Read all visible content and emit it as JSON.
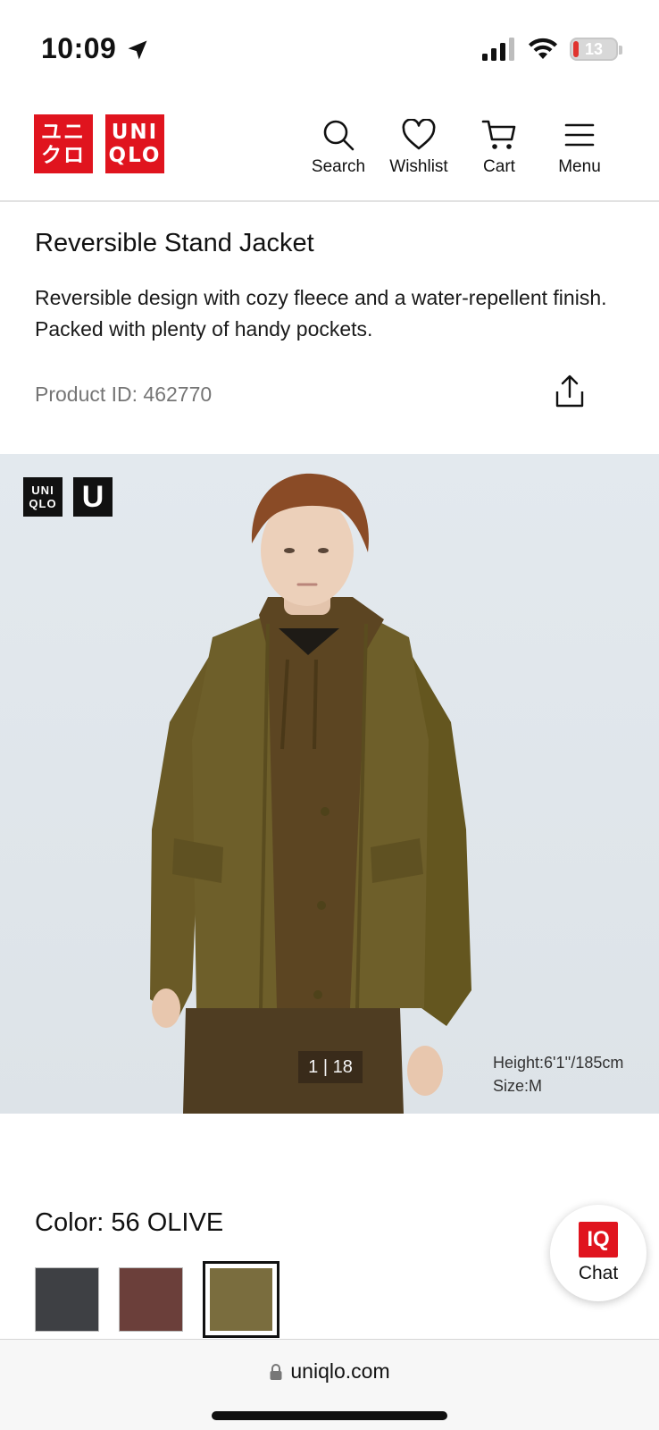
{
  "status_bar": {
    "time": "10:09",
    "battery_level": "13",
    "battery_fraction": 0.13
  },
  "header": {
    "logo_katakana_top": "ユニ",
    "logo_katakana_bottom": "クロ",
    "logo_latin_top": "UNI",
    "logo_latin_bottom": "QLO",
    "nav": {
      "search": "Search",
      "wishlist": "Wishlist",
      "cart": "Cart",
      "menu": "Menu"
    }
  },
  "product": {
    "title": "Reversible Stand Jacket",
    "description": "Reversible design with cozy fleece and a water-repellent finish. Packed with plenty of handy pockets.",
    "product_id": "Product ID: 462770"
  },
  "gallery": {
    "badge_uniqlo_top": "UNI",
    "badge_uniqlo_bottom": "QLO",
    "badge_u": "U",
    "counter": "1 | 18",
    "model_height": "Height:6'1''/185cm",
    "model_size": "Size:M"
  },
  "color": {
    "label": "Color:  56 OLIVE",
    "swatches": [
      {
        "name": "dark gray",
        "hex": "#3e4044",
        "selected": false
      },
      {
        "name": "brown",
        "hex": "#6b3f3a",
        "selected": false
      },
      {
        "name": "olive",
        "hex": "#7a6d3e",
        "selected": true
      }
    ]
  },
  "chat": {
    "badge": "IQ",
    "label": "Chat"
  },
  "browser": {
    "url": "uniqlo.com"
  },
  "colors": {
    "brand_red": "#e0141e",
    "olive": "#6e5f2a"
  }
}
